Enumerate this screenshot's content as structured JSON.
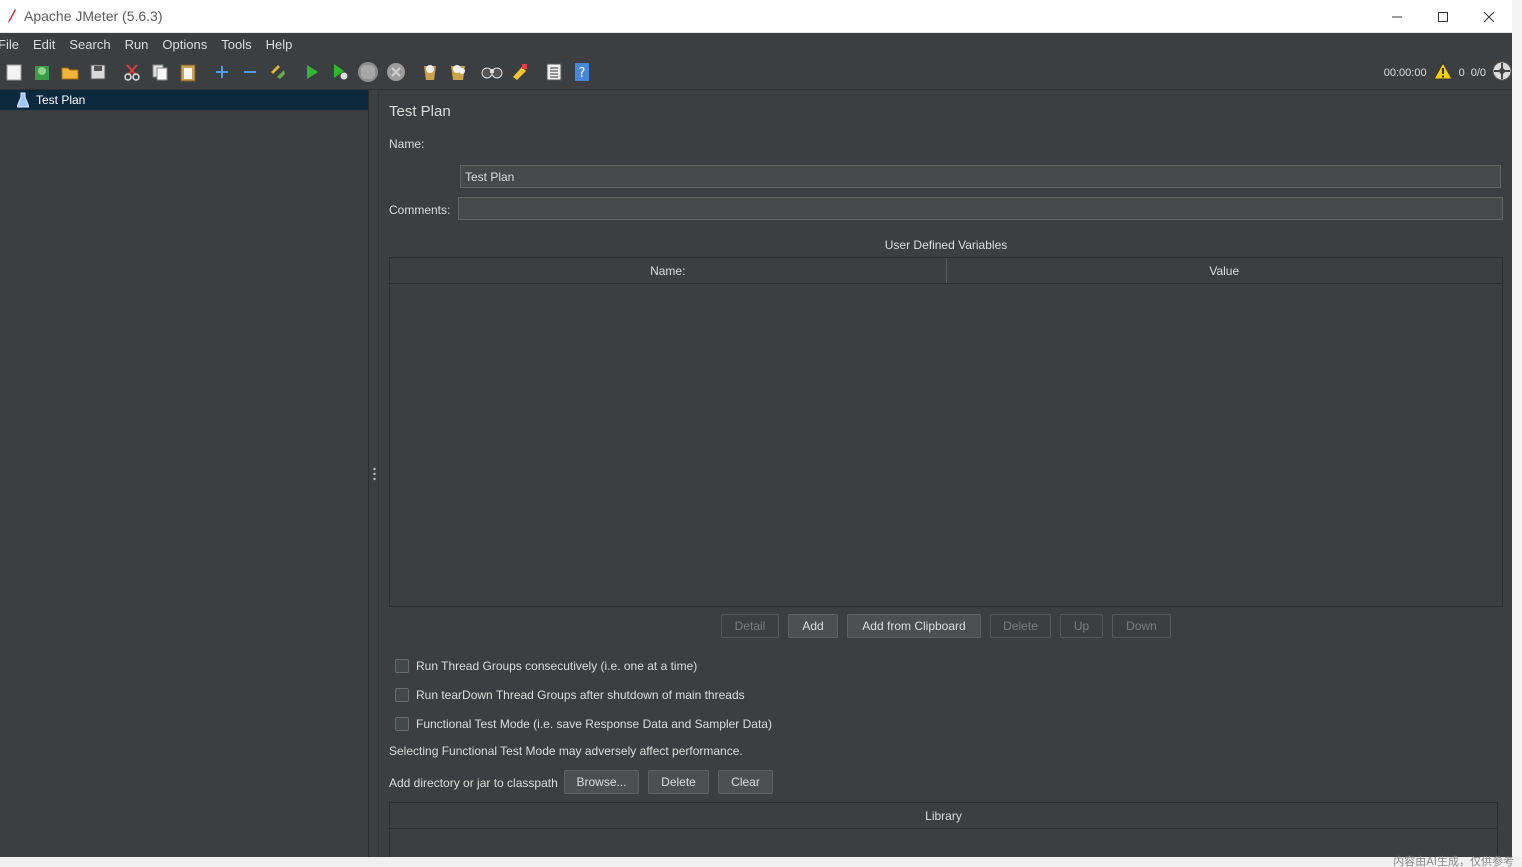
{
  "window": {
    "title": "Apache JMeter (5.6.3)",
    "minimize_icon": "minimize-icon",
    "maximize_icon": "maximize-icon",
    "close_icon": "close-icon"
  },
  "menu": [
    "File",
    "Edit",
    "Search",
    "Run",
    "Options",
    "Tools",
    "Help"
  ],
  "toolbar": {
    "icons": [
      "new-icon",
      "templates-icon",
      "open-icon",
      "save-icon",
      "cut-icon",
      "copy-icon",
      "paste-icon",
      "expand-icon",
      "collapse-icon",
      "toggle-icon",
      "start-icon",
      "start-no-pause-icon",
      "stop-icon",
      "shutdown-icon",
      "clear-icon",
      "clear-all-icon",
      "search-icon",
      "reset-search-icon",
      "function-helper-icon",
      "help-icon"
    ],
    "timer": "00:00:00",
    "warning_count": "0",
    "threads": "0/0"
  },
  "tree": {
    "items": [
      {
        "label": "Test Plan",
        "icon": "test-plan-icon",
        "selected": true
      }
    ]
  },
  "test_plan": {
    "title": "Test Plan",
    "name_label": "Name:",
    "name_value": "Test Plan",
    "comments_label": "Comments:",
    "comments_value": "",
    "udv_title": "User Defined Variables",
    "udv_columns": [
      "Name:",
      "Value"
    ],
    "udv_buttons": [
      {
        "label": "Detail",
        "enabled": false
      },
      {
        "label": "Add",
        "enabled": true
      },
      {
        "label": "Add from Clipboard",
        "enabled": true
      },
      {
        "label": "Delete",
        "enabled": false
      },
      {
        "label": "Up",
        "enabled": false
      },
      {
        "label": "Down",
        "enabled": false
      }
    ],
    "options": [
      {
        "label": "Run Thread Groups consecutively (i.e. one at a time)",
        "checked": false
      },
      {
        "label": "Run tearDown Thread Groups after shutdown of main threads",
        "checked": false
      },
      {
        "label": "Functional Test Mode (i.e. save Response Data and Sampler Data)",
        "checked": false
      }
    ],
    "functional_note": "Selecting Functional Test Mode may adversely affect performance.",
    "classpath_label": "Add directory or jar to classpath",
    "classpath_buttons": [
      "Browse...",
      "Delete",
      "Clear"
    ],
    "library_column": "Library"
  },
  "desktop": {
    "caption": "内容由AI生成，仅供参考"
  }
}
